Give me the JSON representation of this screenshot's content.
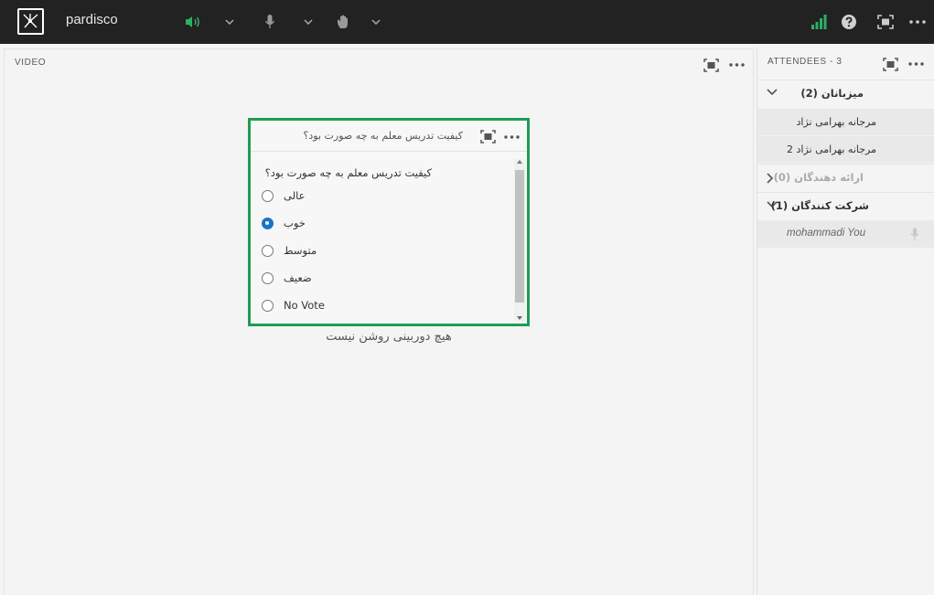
{
  "header": {
    "app_name": "pardisco",
    "icons": [
      "logo-icon",
      "speaker-icon",
      "chevron-down-icon",
      "microphone-icon",
      "hand-icon",
      "signal-icon",
      "help-icon",
      "fullscreen-icon",
      "more-icon"
    ],
    "colors": {
      "bar": "#222222",
      "speaker_active": "#2fae67",
      "signal": "#2fae67"
    }
  },
  "video": {
    "title": "VIDEO",
    "no_camera_text": "هیچ دوربینی روشن نیست"
  },
  "poll": {
    "title": "کیفیت تدریس معلم به چه صورت بود؟",
    "question": "کیفیت تدریس معلم به چه صورت بود؟",
    "options": [
      {
        "label": "عالی",
        "selected": false
      },
      {
        "label": "خوب",
        "selected": true
      },
      {
        "label": "متوسط",
        "selected": false
      },
      {
        "label": "ضعیف",
        "selected": false
      },
      {
        "label": "No Vote",
        "selected": false
      }
    ],
    "border_color": "#1f9d55"
  },
  "attendees": {
    "title": "ATTENDEES - 3",
    "groups": [
      {
        "label": "میزبانان (2)",
        "expanded": true,
        "members": [
          "مرجانه بهرامی نژاد",
          "مرجانه بهرامی نژاد 2"
        ]
      },
      {
        "label": "ارائه دهندگان (0)",
        "expanded": false,
        "members": []
      },
      {
        "label": "شرکت کنندگان (1)",
        "expanded": true,
        "members": [
          "mohammadi You"
        ]
      }
    ]
  }
}
